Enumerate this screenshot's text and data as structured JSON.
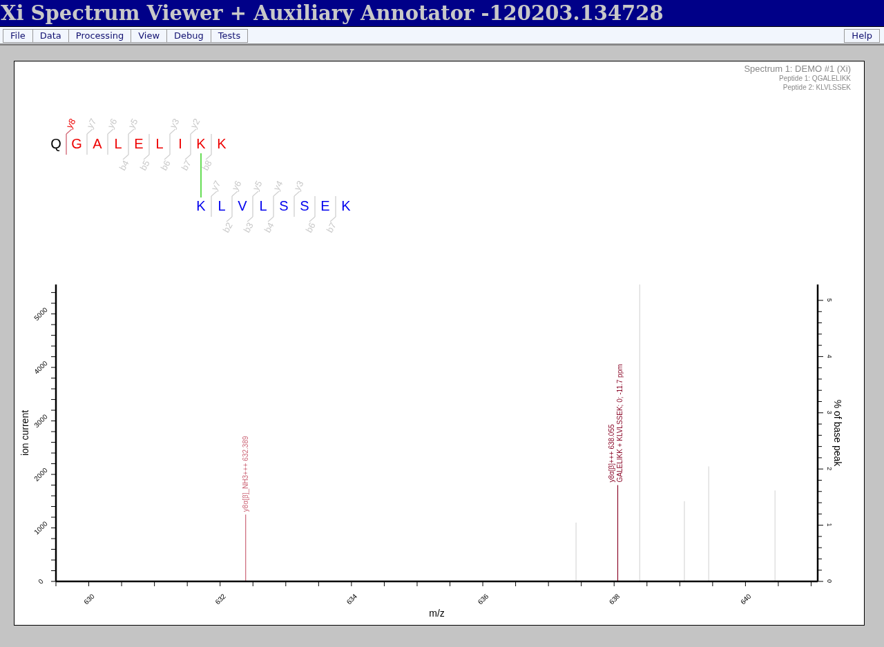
{
  "window": {
    "title": "Xi Spectrum Viewer + Auxiliary Annotator -120203.134728"
  },
  "menu": [
    {
      "label": "File"
    },
    {
      "label": "Data"
    },
    {
      "label": "Processing"
    },
    {
      "label": "View"
    },
    {
      "label": "Debug"
    },
    {
      "label": "Tests"
    }
  ],
  "help": {
    "label": "Help"
  },
  "spectrum_info": {
    "title": "Spectrum 1: DEMO #1 (Xi)",
    "lines": [
      "Peptide 1: QGALELIKK",
      "Peptide 2: KLVLSSEK"
    ]
  },
  "peptides": [
    {
      "residues": [
        {
          "letter": "Q",
          "color": "#000000"
        },
        {
          "letter": "G",
          "color": "#ee0000"
        },
        {
          "letter": "A",
          "color": "#ee0000"
        },
        {
          "letter": "L",
          "color": "#ee0000"
        },
        {
          "letter": "E",
          "color": "#ee0000"
        },
        {
          "letter": "L",
          "color": "#ee0000"
        },
        {
          "letter": "I",
          "color": "#ee0000"
        },
        {
          "letter": "K",
          "color": "#ee0000",
          "crosslinked": true
        },
        {
          "letter": "K",
          "color": "#ee0000"
        }
      ],
      "cleavages": [
        {
          "y": "y8",
          "y_matched": true
        },
        {
          "y": "y7",
          "y_matched": false
        },
        {
          "y": "y6",
          "y_matched": false
        },
        {
          "y": "y5",
          "y_matched": false,
          "b": "b4",
          "b_matched": false
        },
        {
          "b": "b5",
          "b_matched": false
        },
        {
          "y": "y3",
          "y_matched": false,
          "b": "b6",
          "b_matched": false
        },
        {
          "y": "y2",
          "y_matched": false,
          "b": "b7",
          "b_matched": false
        },
        {
          "b": "b8",
          "b_matched": false
        }
      ]
    },
    {
      "residues": [
        {
          "letter": "K",
          "color": "#0000ee",
          "crosslinked": true
        },
        {
          "letter": "L",
          "color": "#0000ee"
        },
        {
          "letter": "V",
          "color": "#0000ee"
        },
        {
          "letter": "L",
          "color": "#0000ee"
        },
        {
          "letter": "S",
          "color": "#0000ee"
        },
        {
          "letter": "S",
          "color": "#0000ee"
        },
        {
          "letter": "E",
          "color": "#0000ee"
        },
        {
          "letter": "K",
          "color": "#0000ee"
        }
      ],
      "cleavages": [
        {
          "y": "y7",
          "y_matched": false
        },
        {
          "y": "y6",
          "y_matched": false,
          "b": "b2",
          "b_matched": false
        },
        {
          "y": "y5",
          "y_matched": false,
          "b": "b3",
          "b_matched": false
        },
        {
          "y": "y4",
          "y_matched": false,
          "b": "b4",
          "b_matched": false
        },
        {
          "y": "y3",
          "y_matched": false
        },
        {
          "b": "b6",
          "b_matched": false
        },
        {
          "b": "b7",
          "b_matched": false
        }
      ]
    }
  ],
  "spectrum": {
    "chart_data": {
      "type": "bar",
      "xlabel": "m/z",
      "ylabel": "ion current",
      "x": [
        632.389,
        637.42,
        638.055,
        638.39,
        639.07,
        639.44,
        640.45
      ],
      "series": [
        {
          "color": "#cc6677",
          "values": [
            1250,
            null,
            null,
            null,
            null,
            null,
            null
          ]
        },
        {
          "color": "#8b0a2a",
          "values": [
            null,
            null,
            1800,
            null,
            null,
            null,
            null
          ]
        },
        {
          "color": "#d8d8d8",
          "values": [
            null,
            1100,
            null,
            5550,
            1500,
            2150,
            1700
          ]
        }
      ],
      "xlim": [
        629.5,
        641.1
      ],
      "ylim": [
        0,
        5550
      ],
      "xticks": [
        630,
        632,
        634,
        636,
        638,
        640
      ],
      "yticks": [
        0,
        1000,
        2000,
        3000,
        4000,
        5000
      ],
      "value_labels": [
        "y8α[β]_NH3+++ 632.389",
        null,
        "y8α[β]+++ 638.055\nGALELIKK + KLVLSSEK; 0; -11.7 ppm",
        null,
        null,
        null,
        null
      ]
    },
    "right_axis": {
      "label": "% of base peak",
      "ticks": [
        "0",
        "1",
        "2",
        "3",
        "4",
        "5"
      ]
    }
  }
}
